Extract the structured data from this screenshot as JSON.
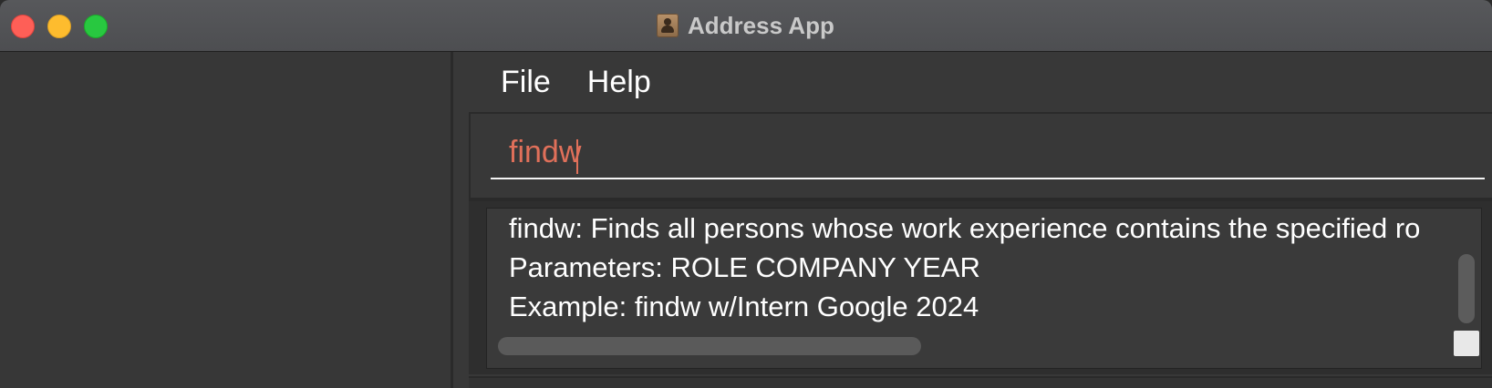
{
  "window": {
    "title": "Address App",
    "title_icon": "address-book-icon",
    "traffic_lights": [
      "close",
      "minimize",
      "maximize"
    ]
  },
  "menubar": {
    "items": [
      {
        "label": "File"
      },
      {
        "label": "Help"
      }
    ]
  },
  "command_box": {
    "value": "findw",
    "text_color": "#e0705a"
  },
  "result_display": {
    "lines": [
      "findw: Finds all persons whose work experience contains the specified ro",
      "Parameters: ROLE COMPANY YEAR",
      "Example: findw w/Intern Google 2024"
    ]
  },
  "colors": {
    "background": "#383838",
    "close": "#fe5f57",
    "minimize": "#febc2e",
    "maximize": "#28c840"
  }
}
